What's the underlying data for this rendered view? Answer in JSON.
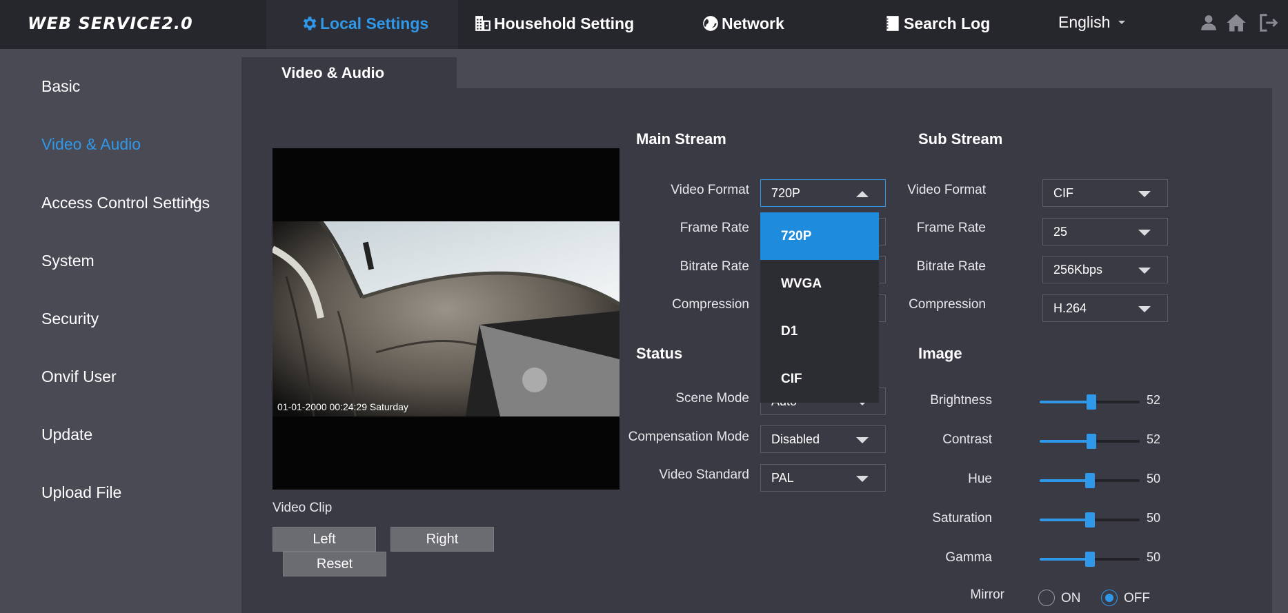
{
  "app": {
    "logo": "WEB SERVICE2.0"
  },
  "topnav": {
    "local": "Local Settings",
    "household": "Household Setting",
    "network": "Network",
    "searchlog": "Search Log",
    "language": "English"
  },
  "sidebar": {
    "basic": "Basic",
    "video_audio": "Video & Audio",
    "access_control": "Access Control Settings",
    "system": "System",
    "security": "Security",
    "onvif": "Onvif User",
    "update": "Update",
    "upload": "Upload File"
  },
  "panel": {
    "tab": "Video & Audio"
  },
  "video": {
    "timestamp": "01-01-2000 00:24:29 Saturday",
    "clip_label": "Video Clip",
    "left": "Left",
    "right": "Right",
    "reset": "Reset"
  },
  "main_stream": {
    "heading": "Main Stream",
    "video_format_label": "Video Format",
    "video_format": "720P",
    "frame_rate_label": "Frame Rate",
    "bitrate_label": "Bitrate Rate",
    "compression_label": "Compression",
    "dropdown_options": [
      "720P",
      "WVGA",
      "D1",
      "CIF"
    ]
  },
  "status": {
    "heading": "Status",
    "scene_mode_label": "Scene Mode",
    "scene_mode": "Auto",
    "compensation_label": "Compensation Mode",
    "compensation": "Disabled",
    "video_standard_label": "Video Standard",
    "video_standard": "PAL"
  },
  "sub_stream": {
    "heading": "Sub Stream",
    "video_format_label": "Video Format",
    "video_format": "CIF",
    "frame_rate_label": "Frame Rate",
    "frame_rate": "25",
    "bitrate_label": "Bitrate Rate",
    "bitrate": "256Kbps",
    "compression_label": "Compression",
    "compression": "H.264"
  },
  "image": {
    "heading": "Image",
    "sliders": [
      {
        "label": "Brightness",
        "value": "52",
        "fraction": 0.52
      },
      {
        "label": "Contrast",
        "value": "52",
        "fraction": 0.52
      },
      {
        "label": "Hue",
        "value": "50",
        "fraction": 0.5
      },
      {
        "label": "Saturation",
        "value": "50",
        "fraction": 0.5
      },
      {
        "label": "Gamma",
        "value": "50",
        "fraction": 0.5
      }
    ],
    "mirror_label": "Mirror",
    "mirror_on": "ON",
    "mirror_off": "OFF",
    "mirror_selected": "OFF"
  },
  "colors": {
    "accent": "#2f98e8",
    "topbar": "#26262d",
    "panel": "#3a3a44",
    "page": "#4a4a55"
  }
}
